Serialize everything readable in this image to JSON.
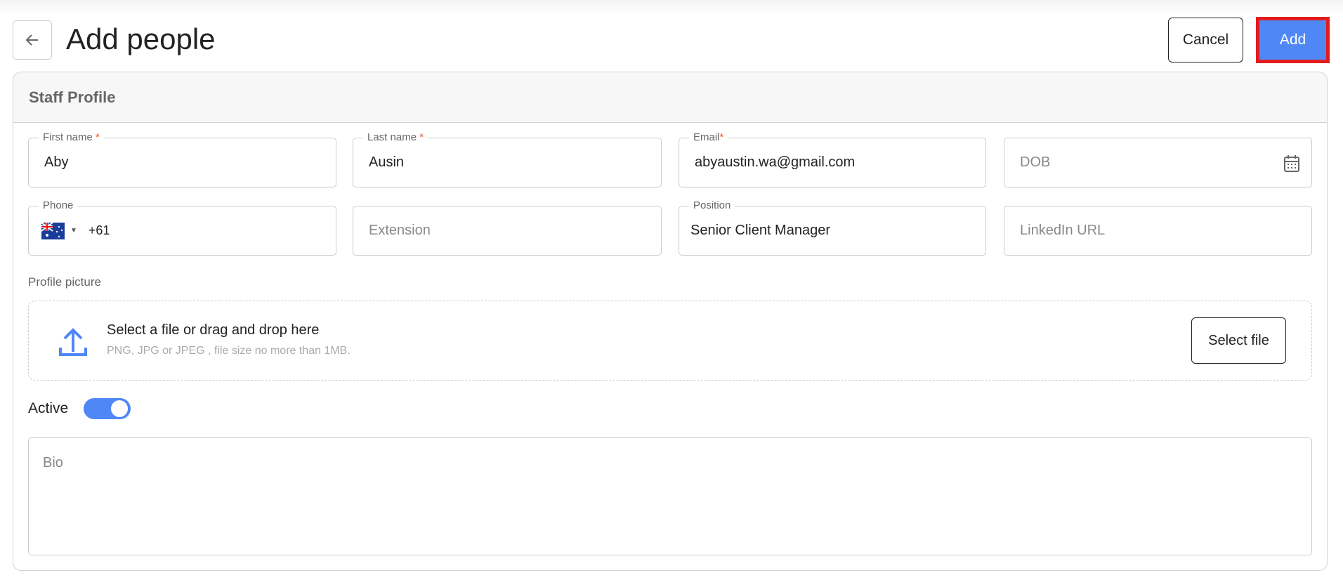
{
  "header": {
    "title": "Add people",
    "cancel_label": "Cancel",
    "add_label": "Add"
  },
  "card": {
    "title": "Staff Profile"
  },
  "fields": {
    "first_name": {
      "label": "First name",
      "required": "*",
      "value": "Aby"
    },
    "last_name": {
      "label": "Last name",
      "required": "*",
      "value": "Ausin"
    },
    "email": {
      "label": "Email",
      "required": "*",
      "value": "abyaustin.wa@gmail.com"
    },
    "dob": {
      "placeholder": "DOB"
    },
    "phone": {
      "label": "Phone",
      "country": "AU",
      "value": "+61"
    },
    "extension": {
      "placeholder": "Extension"
    },
    "position": {
      "label": "Position",
      "value": "Senior Client Manager"
    },
    "linkedin": {
      "placeholder": "LinkedIn URL"
    }
  },
  "profile_picture": {
    "label": "Profile picture",
    "title": "Select a file or drag and drop here",
    "hint": "PNG, JPG or JPEG , file size no more than 1MB.",
    "button": "Select file"
  },
  "active": {
    "label": "Active",
    "on": true
  },
  "bio": {
    "placeholder": "Bio"
  },
  "colors": {
    "accent": "#4f87f7",
    "highlight": "#e31b1b",
    "required": "#f05a3c"
  }
}
